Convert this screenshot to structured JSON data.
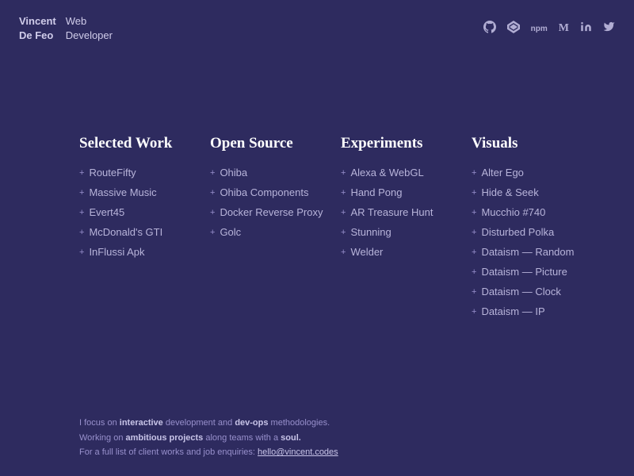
{
  "header": {
    "name_line1": "Vincent",
    "name_line2": "De Feo",
    "title_line1": "Web",
    "title_line2": "Developer",
    "icons": [
      {
        "name": "github-icon",
        "glyph": "⌥",
        "label": "GitHub"
      },
      {
        "name": "codepen-icon",
        "glyph": "◎",
        "label": "CodePen"
      },
      {
        "name": "npm-icon",
        "glyph": "▣",
        "label": "NPM"
      },
      {
        "name": "medium-icon",
        "glyph": "M",
        "label": "Medium"
      },
      {
        "name": "linkedin-icon",
        "glyph": "in",
        "label": "LinkedIn"
      },
      {
        "name": "twitter-icon",
        "glyph": "🐦",
        "label": "Twitter"
      }
    ]
  },
  "columns": [
    {
      "id": "selected-work",
      "title": "Selected Work",
      "items": [
        "RouteFifty",
        "Massive Music",
        "Evert45",
        "McDonald's GTI",
        "InFlussi Apk"
      ]
    },
    {
      "id": "open-source",
      "title": "Open Source",
      "items": [
        "Ohiba",
        "Ohiba Components",
        "Docker Reverse Proxy",
        "Golc"
      ]
    },
    {
      "id": "experiments",
      "title": "Experiments",
      "items": [
        "Alexa & WebGL",
        "Hand Pong",
        "AR Treasure Hunt",
        "Stunning",
        "Welder"
      ]
    },
    {
      "id": "visuals",
      "title": "Visuals",
      "items": [
        "Alter Ego",
        "Hide & Seek",
        "Mucchio #740",
        "Disturbed Polka",
        "Dataism — Random",
        "Dataism — Picture",
        "Dataism — Clock",
        "Dataism — IP"
      ]
    }
  ],
  "footer": {
    "line1_pre": "I focus on ",
    "line1_bold1": "interactive",
    "line1_mid": " development and ",
    "line1_bold2": "dev-ops",
    "line1_post": " methodologies.",
    "line2_pre": "Working on ",
    "line2_bold": "ambitious projects",
    "line2_post": " along teams with a ",
    "line2_soul": "soul.",
    "line3_pre": "For a full list of client works and job enquiries: ",
    "line3_email": "hello@vincent.codes"
  }
}
